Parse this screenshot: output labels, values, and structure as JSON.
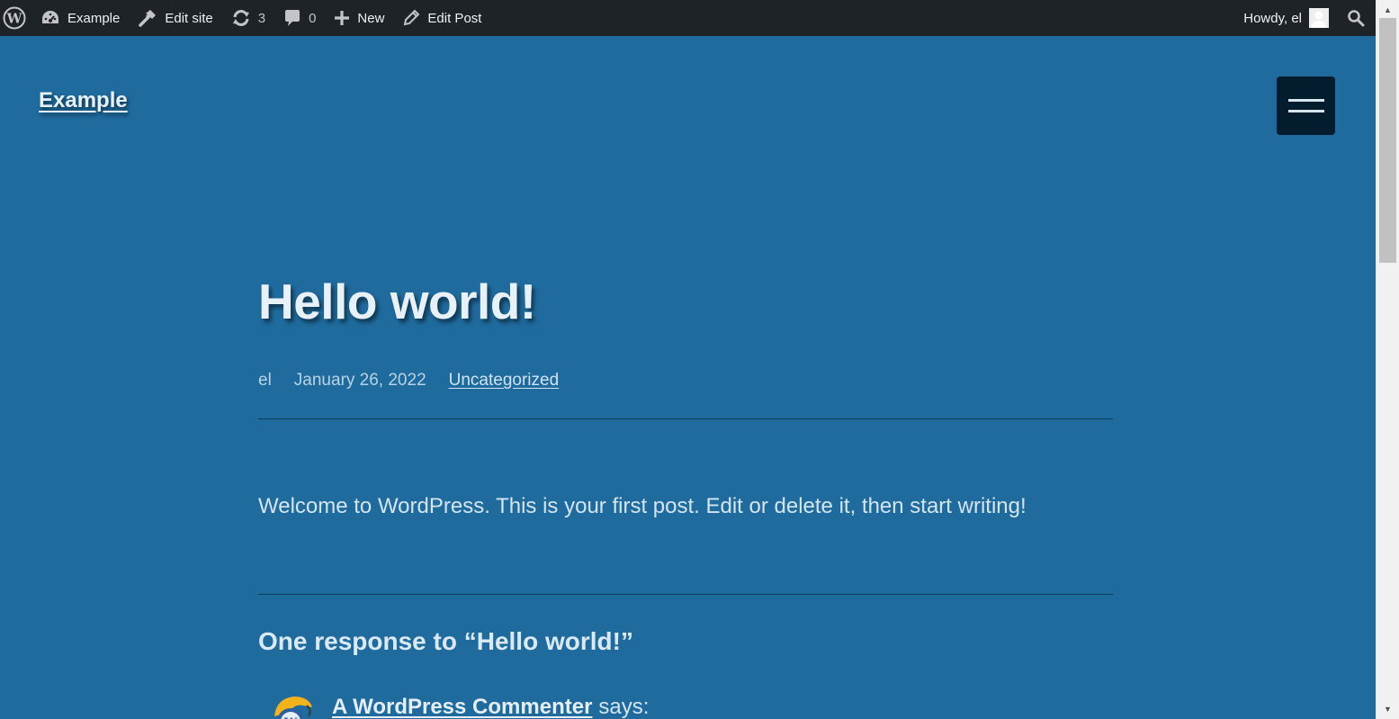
{
  "adminbar": {
    "wp_logo_icon": "wordpress-logo-icon",
    "site_name": "Example",
    "edit_site": "Edit site",
    "updates_count": "3",
    "comments_count": "0",
    "new_label": "New",
    "edit_post": "Edit Post",
    "howdy": "Howdy, el"
  },
  "header": {
    "site_title": "Example"
  },
  "post": {
    "title": "Hello world!",
    "author": "el",
    "date": "January 26, 2022",
    "category": "Uncategorized",
    "body": "Welcome to WordPress. This is your first post. Edit or delete it, then start writing!"
  },
  "comments": {
    "heading": "One response to “Hello world!”",
    "commenter": "A WordPress Commenter",
    "says": "says:"
  },
  "colors": {
    "background": "#1f6b9e",
    "adminbar": "#1d2327",
    "menu_button": "#031d2e"
  }
}
